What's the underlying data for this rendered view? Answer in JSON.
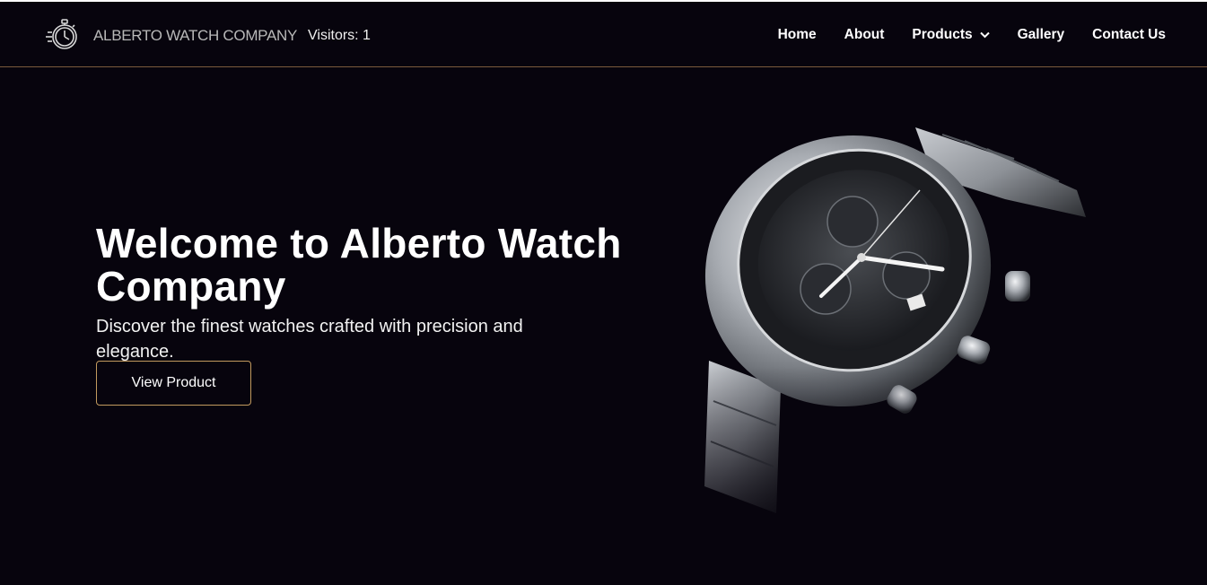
{
  "header": {
    "brand": "ALBERTO WATCH COMPANY",
    "visitors": "Visitors: 1",
    "nav": {
      "home": "Home",
      "about": "About",
      "products": "Products",
      "gallery": "Gallery",
      "contact": "Contact Us"
    }
  },
  "hero": {
    "title": "Welcome to Alberto Watch Company",
    "subtitle": "Discover the finest watches crafted with precision and elegance.",
    "cta_label": "View Product",
    "image_icon": "wristwatch-chronograph"
  },
  "icons": {
    "logo": "stopwatch-icon",
    "products_dropdown": "chevron-down-icon"
  },
  "colors": {
    "background": "#07040d",
    "accent_border": "#c29a5e",
    "header_rule": "#7a5a3c",
    "text": "#ffffff",
    "brand_text": "#b8b8b8"
  }
}
